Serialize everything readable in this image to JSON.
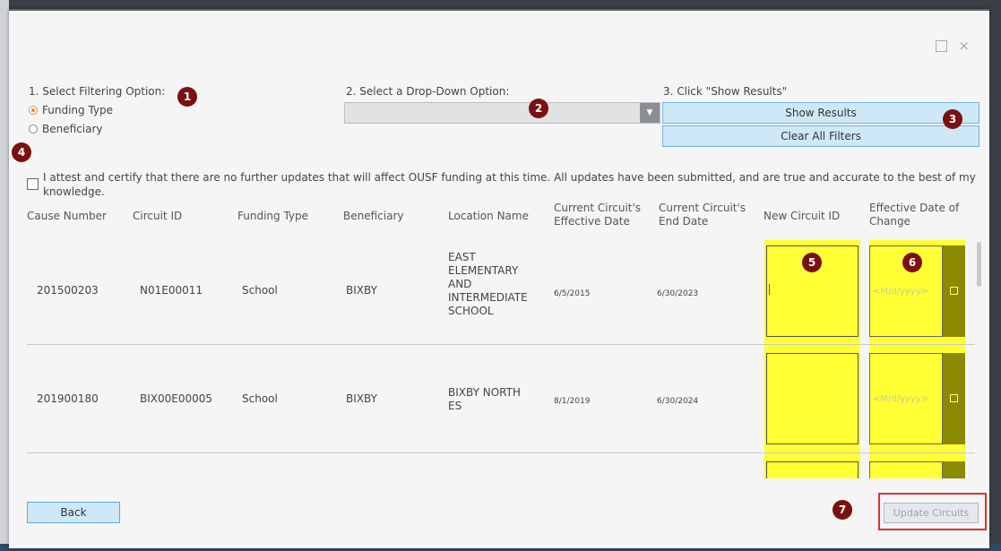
{
  "window": {
    "maximize_icon": "maximize-icon",
    "close_label": "×"
  },
  "step1": {
    "label": "1. Select Filtering Option:",
    "options": [
      "Funding Type",
      "Beneficiary"
    ],
    "selected": "Funding Type"
  },
  "step2": {
    "label": "2. Select a Drop-Down Option:",
    "value": ""
  },
  "step3": {
    "label": "3. Click \"Show Results\"",
    "show_results": "Show Results",
    "clear_filters": "Clear All Filters"
  },
  "attest": {
    "text": "I attest and certify that there are no further updates that will affect OUSF funding at this time. All updates have been submitted, and are true and accurate to the best of my knowledge.",
    "checked": false
  },
  "markers": [
    "1",
    "2",
    "3",
    "4",
    "5",
    "6",
    "7"
  ],
  "table": {
    "headers": {
      "cause_number": "Cause Number",
      "circuit_id": "Circuit ID",
      "funding_type": "Funding Type",
      "beneficiary": "Beneficiary",
      "location_name": "Location Name",
      "current_effective_l1": "Current Circuit's",
      "current_effective_l2": "Effective Date",
      "current_end_l1": "Current Circuit's",
      "current_end_l2": "End Date",
      "new_circuit_id": "New Circuit ID",
      "effective_change_l1": "Effective Date of",
      "effective_change_l2": "Change"
    },
    "rows": [
      {
        "cause_number": "201500203",
        "circuit_id": "N01E00011",
        "funding_type": "School",
        "beneficiary": "BIXBY",
        "location_lines": [
          "EAST",
          "ELEMENTARY",
          "AND",
          "INTERMEDIATE",
          "SCHOOL"
        ],
        "effective_date": "6/5/2015",
        "end_date": "6/30/2023",
        "new_circuit_id": "",
        "date_placeholder": "<M/d/yyyy>"
      },
      {
        "cause_number": "201900180",
        "circuit_id": "BIX00E00005",
        "funding_type": "School",
        "beneficiary": "BIXBY",
        "location_lines": [
          "BIXBY NORTH",
          "ES"
        ],
        "effective_date": "8/1/2019",
        "end_date": "6/30/2024",
        "new_circuit_id": "",
        "date_placeholder": "<M/d/yyyy>"
      }
    ]
  },
  "footer": {
    "back": "Back",
    "update": "Update Circuits"
  },
  "colors": {
    "highlight": "#ffff33",
    "marker": "#7a1010",
    "button": "#cfe8f7",
    "radio_selected": "#e28f3c",
    "outline": "#e03030"
  }
}
